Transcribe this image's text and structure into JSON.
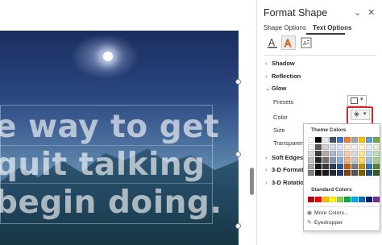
{
  "slide": {
    "lines": [
      "e way to get",
      "quit  talking",
      "begin doing."
    ]
  },
  "pane": {
    "title": "Format Shape",
    "tabs": [
      {
        "label": "Shape Options",
        "active": false
      },
      {
        "label": "Text Options",
        "active": true
      }
    ],
    "icons": [
      "text-fill-outline-icon",
      "text-effects-icon",
      "textbox-icon"
    ],
    "sections": {
      "shadow": "Shadow",
      "reflection": "Reflection",
      "glow": "Glow",
      "soft_edges": "Soft Edges",
      "format_3d": "3-D Format",
      "rotation_3d": "3-D Rotation"
    },
    "glow_options": {
      "presets": "Presets",
      "color": "Color",
      "size": "Size",
      "transparency": "Transparency"
    }
  },
  "palette": {
    "theme_colors_label": "Theme Colors",
    "standard_colors_label": "Standard Colors",
    "more_colors_label": "More Colors...",
    "eyedropper_label": "Eyedropper",
    "theme_columns": [
      [
        "#ffffff",
        "#f2f2f2",
        "#d9d9d9",
        "#bfbfbf",
        "#a6a6a6",
        "#808080"
      ],
      [
        "#000000",
        "#595959",
        "#404040",
        "#262626",
        "#171717",
        "#0d0d0d"
      ],
      [
        "#e7e6e6",
        "#d0cece",
        "#aeabab",
        "#757171",
        "#3b3838",
        "#171616"
      ],
      [
        "#44546a",
        "#d6dce5",
        "#adb9ca",
        "#8497b0",
        "#333f50",
        "#222a35"
      ],
      [
        "#4472c4",
        "#dae3f3",
        "#b4c7e7",
        "#8faadc",
        "#2f5597",
        "#1f3864"
      ],
      [
        "#ed7d31",
        "#fbe5d6",
        "#f8cbad",
        "#f4b183",
        "#c55a11",
        "#843c0c"
      ],
      [
        "#a5a5a5",
        "#ededed",
        "#dbdbdb",
        "#c9c9c9",
        "#7b7b7b",
        "#525252"
      ],
      [
        "#ffc000",
        "#fff2cc",
        "#ffe699",
        "#ffd966",
        "#bf9000",
        "#7f6000"
      ],
      [
        "#5b9bd5",
        "#deebf7",
        "#bdd7ee",
        "#9dc3e6",
        "#2e75b6",
        "#1f4e79"
      ],
      [
        "#70ad47",
        "#e2f0d9",
        "#c5e0b4",
        "#a9d18e",
        "#548235",
        "#385723"
      ]
    ],
    "standard_colors": [
      "#c00000",
      "#ff0000",
      "#ffc000",
      "#ffff00",
      "#92d050",
      "#00b050",
      "#00b0f0",
      "#0070c0",
      "#002060",
      "#7030a0"
    ]
  }
}
